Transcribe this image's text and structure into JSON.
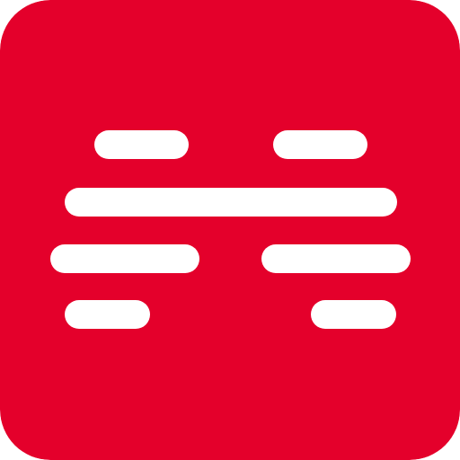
{
  "icon": {
    "name": "app-logo-icon",
    "background_color": "#E4002B",
    "bar_color": "#FFFFFF"
  }
}
